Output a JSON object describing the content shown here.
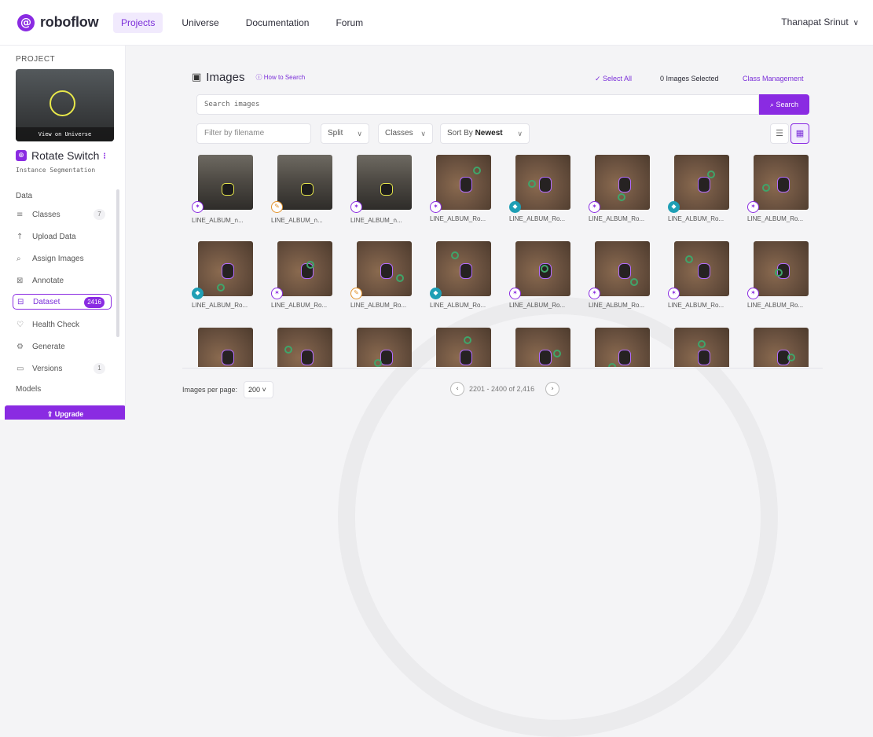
{
  "brand": {
    "logo_mark": "@",
    "name": "roboflow"
  },
  "nav": [
    {
      "label": "Projects",
      "active": true
    },
    {
      "label": "Universe",
      "active": false
    },
    {
      "label": "Documentation",
      "active": false
    },
    {
      "label": "Forum",
      "active": false
    }
  ],
  "user": {
    "name": "Thanapat Srinut",
    "chevron": "∨"
  },
  "sidebar": {
    "project_label": "PROJECT",
    "view_on_universe": "View on Universe",
    "project_icon": "⊕",
    "project_name": "Rotate Switch",
    "project_more": "⁝",
    "project_type": "Instance Segmentation",
    "data_label": "Data",
    "items": [
      {
        "icon": "≡",
        "label": "Classes",
        "count": "7"
      },
      {
        "icon": "↑",
        "label": "Upload Data",
        "count": ""
      },
      {
        "icon": "⌕",
        "label": "Assign Images",
        "count": ""
      },
      {
        "icon": "⊠",
        "label": "Annotate",
        "count": ""
      },
      {
        "icon": "⊟",
        "label": "Dataset",
        "count": "2416"
      },
      {
        "icon": "♡",
        "label": "Health Check",
        "count": ""
      },
      {
        "icon": "⚙",
        "label": "Generate",
        "count": ""
      },
      {
        "icon": "▭",
        "label": "Versions",
        "count": "1"
      }
    ],
    "models_label": "Models",
    "upgrade_label": "⇪ Upgrade"
  },
  "toolbar": {
    "images_icon": "▣",
    "title": "Images",
    "how_to_search": "ⓘ How to Search",
    "select_all": "✓ Select All",
    "selected": "0 Images Selected",
    "class_management": "Class Management",
    "search_placeholder": "Search images",
    "search_button": "⌕ Search",
    "filter_placeholder": "Filter by filename",
    "split_label": "Split",
    "classes_label": "Classes",
    "sort_prefix": "Sort By",
    "sort_value": "Newest",
    "chev": "∨",
    "list_icon": "☰",
    "grid_icon": "▦"
  },
  "images": [
    {
      "caption": "LINE_ALBUM_ก...",
      "badge": "person",
      "style": "dark"
    },
    {
      "caption": "LINE_ALBUM_ก...",
      "badge": "pencil",
      "style": "dark"
    },
    {
      "caption": "LINE_ALBUM_ก...",
      "badge": "person",
      "style": "dark"
    },
    {
      "caption": "LINE_ALBUM_Ro...",
      "badge": "person",
      "style": "desk"
    },
    {
      "caption": "LINE_ALBUM_Ro...",
      "badge": "shield",
      "style": "desk"
    },
    {
      "caption": "LINE_ALBUM_Ro...",
      "badge": "person",
      "style": "desk"
    },
    {
      "caption": "LINE_ALBUM_Ro...",
      "badge": "shield",
      "style": "desk"
    },
    {
      "caption": "LINE_ALBUM_Ro...",
      "badge": "person",
      "style": "desk"
    },
    {
      "caption": "LINE_ALBUM_Ro...",
      "badge": "shield",
      "style": "desk"
    },
    {
      "caption": "LINE_ALBUM_Ro...",
      "badge": "person",
      "style": "desk"
    },
    {
      "caption": "LINE_ALBUM_Ro...",
      "badge": "pencil",
      "style": "desk"
    },
    {
      "caption": "LINE_ALBUM_Ro...",
      "badge": "shield",
      "style": "desk"
    },
    {
      "caption": "LINE_ALBUM_Ro...",
      "badge": "person",
      "style": "desk"
    },
    {
      "caption": "LINE_ALBUM_Ro...",
      "badge": "person",
      "style": "desk"
    },
    {
      "caption": "LINE_ALBUM_Ro...",
      "badge": "person",
      "style": "desk"
    },
    {
      "caption": "LINE_ALBUM_Ro...",
      "badge": "person",
      "style": "desk"
    },
    {
      "caption": "",
      "badge": "",
      "style": "desk"
    },
    {
      "caption": "",
      "badge": "",
      "style": "desk"
    },
    {
      "caption": "",
      "badge": "",
      "style": "desk"
    },
    {
      "caption": "",
      "badge": "",
      "style": "desk"
    },
    {
      "caption": "",
      "badge": "",
      "style": "desk"
    },
    {
      "caption": "",
      "badge": "",
      "style": "desk"
    },
    {
      "caption": "",
      "badge": "",
      "style": "desk"
    },
    {
      "caption": "",
      "badge": "",
      "style": "desk"
    }
  ],
  "footer": {
    "per_page_label": "Images per page:",
    "per_page_value": "200 ˅",
    "prev": "‹",
    "range": "2201 - 2400 of 2,416",
    "next": "›"
  }
}
